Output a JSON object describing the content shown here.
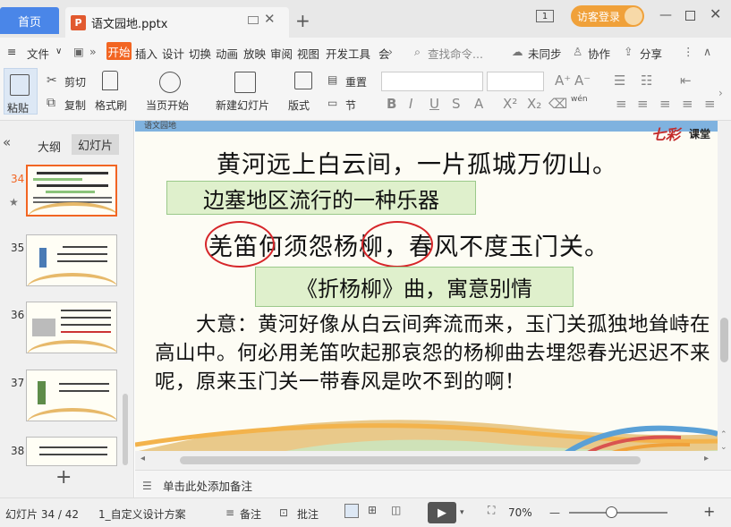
{
  "titlebar": {
    "home_tab": "首页",
    "doc_tab": "语文园地.pptx",
    "ppt_icon_letter": "P",
    "visitor_button": "访客登录",
    "page_badge": "1"
  },
  "menu": {
    "file": "文件",
    "start": "开始",
    "items": [
      "插入",
      "设计",
      "切换",
      "动画",
      "放映",
      "审阅",
      "视图",
      "开发工具",
      "会"
    ],
    "search_placeholder": "查找命令...",
    "unsync": "未同步",
    "collab": "协作",
    "share": "分享"
  },
  "ribbon": {
    "paste": "粘贴",
    "cut": "剪切",
    "copy": "复制",
    "format_painter": "格式刷",
    "from_current": "当页开始",
    "new_slide": "新建幻灯片",
    "layout": "版式",
    "reset": "重置",
    "section": "节",
    "wen": "wén"
  },
  "panel": {
    "tab_outline": "大纲",
    "tab_slides": "幻灯片",
    "thumbnails": [
      {
        "num": "34",
        "active": true
      },
      {
        "num": "35",
        "active": false
      },
      {
        "num": "36",
        "active": false
      },
      {
        "num": "37",
        "active": false
      },
      {
        "num": "38",
        "active": false
      }
    ]
  },
  "slide": {
    "header_text": "语文园地",
    "logo_mark": "七彩",
    "logo_text": "课堂",
    "line1": "黄河远上白云间，一片孤城万仞山。",
    "note1": "边塞地区流行的一种乐器",
    "line2": "羌笛何须怨杨柳，春风不度玉门关。",
    "note2": "《折杨柳》曲，寓意别情",
    "paragraph": "　　大意：黄河好像从白云间奔流而来，玉门关孤独地耸峙在高山中。何必用羌笛吹起那哀怨的杨柳曲去埋怨春光迟迟不来呢，原来玉门关一带春风是吹不到的啊！"
  },
  "notes": {
    "placeholder": "单击此处添加备注"
  },
  "status": {
    "slide_count": "幻灯片 34 / 42",
    "theme": "1_自定义设计方案",
    "notes_btn": "备注",
    "comments_btn": "批注",
    "zoom": "70%"
  }
}
